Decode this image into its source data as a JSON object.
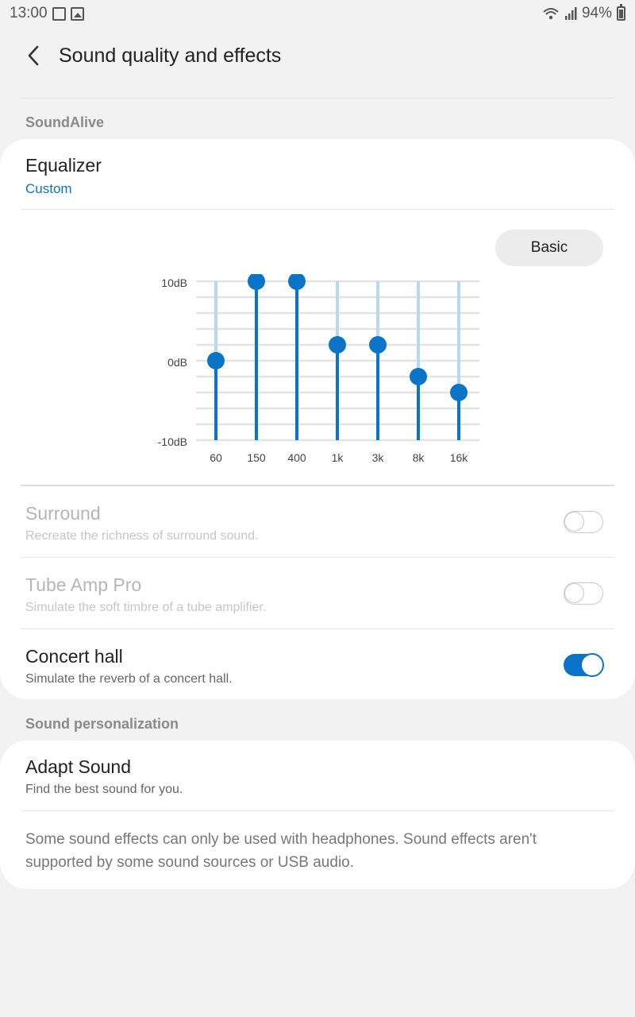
{
  "status": {
    "time": "13:00",
    "battery": "94%"
  },
  "header": {
    "title": "Sound quality and effects"
  },
  "sections": {
    "soundalive": "SoundAlive",
    "personalization": "Sound personalization"
  },
  "equalizer": {
    "title": "Equalizer",
    "preset": "Custom",
    "mode_button": "Basic",
    "db_labels": [
      "10dB",
      "0dB",
      "-10dB"
    ],
    "bands": [
      "60",
      "150",
      "400",
      "1k",
      "3k",
      "8k",
      "16k"
    ],
    "values_db": [
      0,
      10,
      10,
      2,
      2,
      -2,
      -4
    ],
    "range_db": [
      -10,
      10
    ]
  },
  "surround": {
    "title": "Surround",
    "subtitle": "Recreate the richness of surround sound.",
    "enabled": false
  },
  "tube_amp": {
    "title": "Tube Amp Pro",
    "subtitle": "Simulate the soft timbre of a tube amplifier.",
    "enabled": false
  },
  "concert_hall": {
    "title": "Concert hall",
    "subtitle": "Simulate the reverb of a concert hall.",
    "enabled": true
  },
  "adapt_sound": {
    "title": "Adapt Sound",
    "subtitle": "Find the best sound for you."
  },
  "note": "Some sound effects can only be used with headphones. Sound effects aren't supported by some sound sources or USB audio.",
  "colors": {
    "accent": "#0a74c9",
    "track_light": "#b8d8f2",
    "grid": "#e3e3e3"
  }
}
